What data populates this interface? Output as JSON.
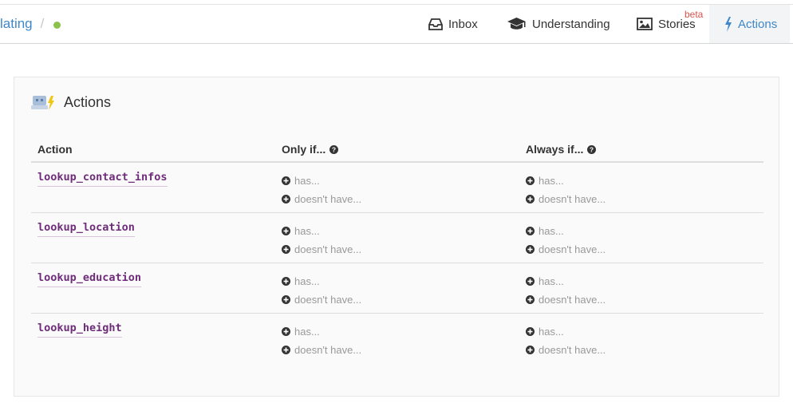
{
  "breadcrumb": {
    "link_text": "lating",
    "separator": "/"
  },
  "nav": {
    "inbox": "Inbox",
    "understanding": "Understanding",
    "stories": "Stories",
    "stories_badge": "beta",
    "actions": "Actions"
  },
  "panel": {
    "title": "Actions"
  },
  "table": {
    "headers": {
      "action": "Action",
      "only_if": "Only if...",
      "always_if": "Always if..."
    },
    "has_label": "has...",
    "doesnt_have_label": "doesn't have...",
    "rows": [
      {
        "name": "lookup_contact_infos"
      },
      {
        "name": "lookup_location"
      },
      {
        "name": "lookup_education"
      },
      {
        "name": "lookup_height"
      }
    ]
  },
  "colors": {
    "accent": "#3f87c8",
    "action_name": "#6f2c7a",
    "status": "#8bc34a",
    "beta": "#d9534f"
  }
}
